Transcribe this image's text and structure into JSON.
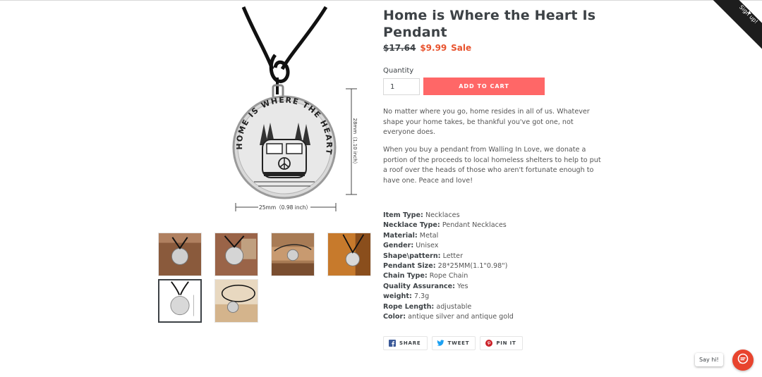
{
  "product": {
    "title": "Home is Where the Heart Is Pendant",
    "old_price": "$17.64",
    "sale_price": "$9.99",
    "sale_label": "Sale",
    "quantity_label": "Quantity",
    "quantity_value": "1",
    "add_to_cart": "ADD TO CART",
    "description": [
      "No matter where you go, home resides in all of us. Whatever shape your home takes, be thankful you've got one, not everyone does.",
      "When you buy a pendant from Walling In Love, we donate a portion of the proceeds to local homeless shelters to help to put a roof over the heads of those who aren't fortunate enough to have one. Peace and love!"
    ],
    "specs": [
      {
        "label": "Item Type:",
        "value": "Necklaces"
      },
      {
        "label": "Necklace Type:",
        "value": "Pendant Necklaces"
      },
      {
        "label": "Material:",
        "value": "Metal"
      },
      {
        "label": "Gender:",
        "value": "Unisex"
      },
      {
        "label": "Shape\\pattern:",
        "value": "Letter"
      },
      {
        "label": "Pendant Size:",
        "value": "28*25MM(1.1\"0.98\")"
      },
      {
        "label": "Chain Type:",
        "value": "Rope Chain"
      },
      {
        "label": "Quality Assurance:",
        "value": "Yes"
      },
      {
        "label": "weight:",
        "value": "7.3g"
      },
      {
        "label": "Rope Length:",
        "value": "adjustable"
      },
      {
        "label": "Color:",
        "value": "antique silver and antique gold"
      }
    ]
  },
  "image": {
    "medallion_text": "HOME IS WHERE THE HEART IS",
    "width_dim": "25mm（0.98 inch）",
    "height_dim": "28mm（1.10 inch）"
  },
  "share": {
    "facebook": "SHARE",
    "twitter": "TWEET",
    "pinterest": "PIN IT"
  },
  "signup_ribbon": "Sign up!",
  "chat_bubble": "Say hi!",
  "colors": {
    "accent": "#ff6767",
    "sale": "#e8532e",
    "text": "#3d4246",
    "chat": "#e8442e",
    "ribbon": "#1d1d1d"
  }
}
